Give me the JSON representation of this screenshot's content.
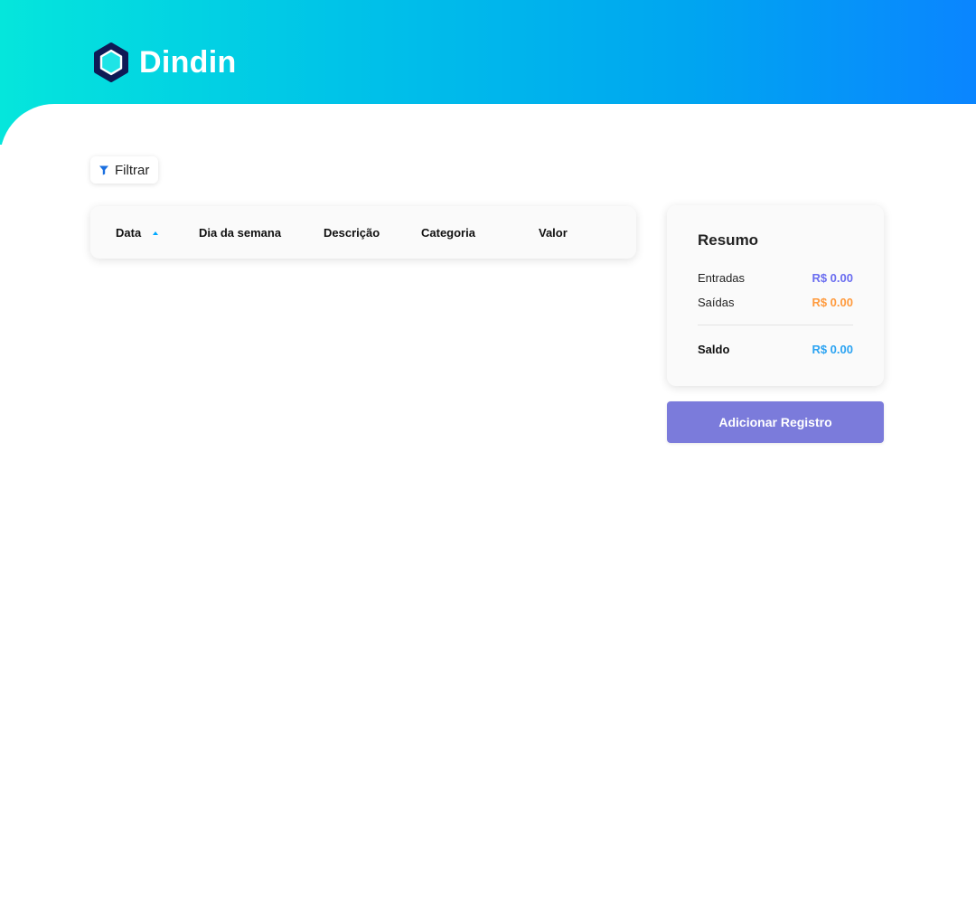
{
  "brand": {
    "name": "Dindin"
  },
  "filter": {
    "label": "Filtrar"
  },
  "table": {
    "columns": [
      {
        "label": "Data",
        "sorted": "ascending"
      },
      {
        "label": "Dia da semana"
      },
      {
        "label": "Descrição"
      },
      {
        "label": "Categoria"
      },
      {
        "label": "Valor"
      }
    ]
  },
  "summary": {
    "title": "Resumo",
    "rows": [
      {
        "label": "Entradas",
        "value": "R$ 0.00"
      },
      {
        "label": "Saídas",
        "value": "R$ 0.00"
      }
    ],
    "balance": {
      "label": "Saldo",
      "value": "R$ 0.00"
    }
  },
  "actions": {
    "add_label": "Adicionar Registro"
  },
  "icons": {
    "logo": "hexagon-logo-icon",
    "filter": "funnel-icon",
    "sort": "sort-ascending-icon"
  },
  "colors": {
    "header_gradient": [
      "#05e6dc",
      "#00c3e8",
      "#00a6f0",
      "#0a85ff"
    ],
    "income": "#6a6df0",
    "expense": "#ff9a3d",
    "balance": "#2ba3f2",
    "primary_button": "#7b7bdb"
  }
}
